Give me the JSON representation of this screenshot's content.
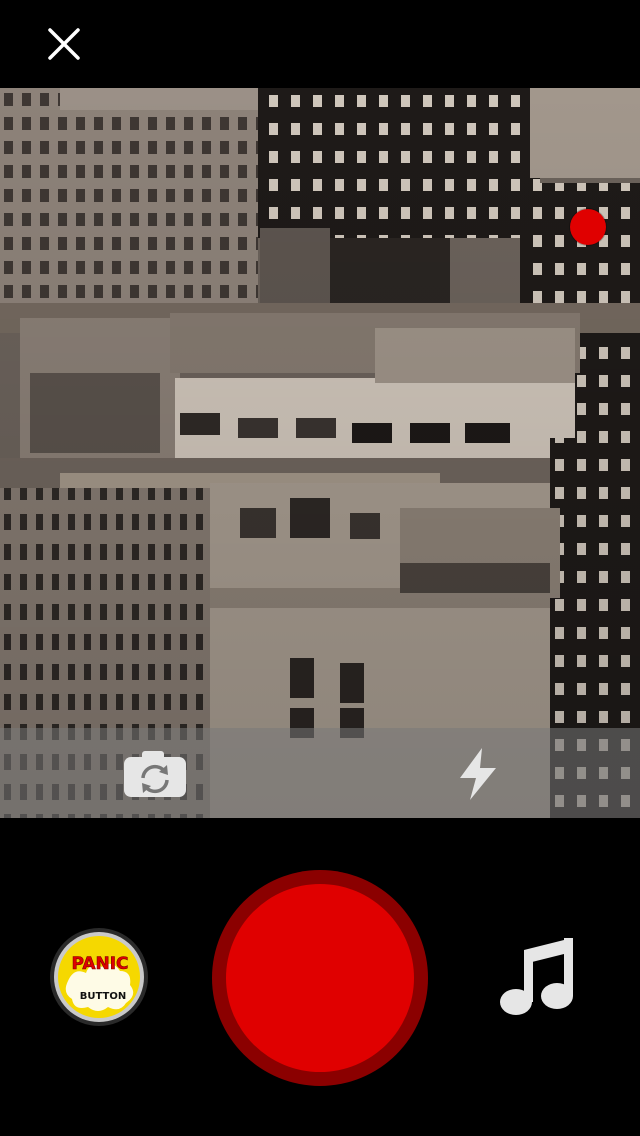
{
  "top_bar": {
    "close_icon": "close-icon"
  },
  "viewfinder": {
    "recording_indicator_color": "#e00000"
  },
  "camera_toolbar": {
    "switch_camera_icon": "switch-camera-icon",
    "flash_icon": "flash-icon"
  },
  "controls": {
    "record_color": "#e00000",
    "record_ring_color": "#8b0000",
    "panic": {
      "line1": "PANIC",
      "line2": "BUTTON"
    },
    "music_icon": "music-note-icon"
  }
}
